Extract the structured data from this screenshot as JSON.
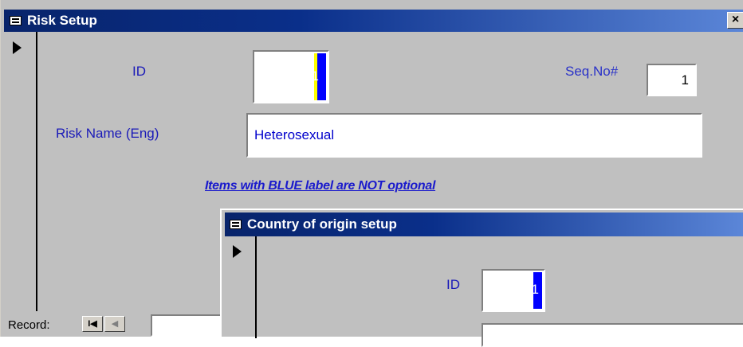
{
  "main_window": {
    "title": "Risk Setup",
    "close_glyph": "×",
    "record_indicator_icon": "current-record-arrow-icon",
    "fields": {
      "id_label": "ID",
      "id_value": "1",
      "seq_label": "Seq.No#",
      "seq_value": "1",
      "risk_name_label": "Risk Name (Eng)",
      "risk_name_value": "Heterosexual"
    },
    "warning_text": "Items with BLUE label are NOT optional",
    "navigation": {
      "record_label": "Record:",
      "first_glyph": "I◀",
      "prev_glyph": "◀"
    }
  },
  "child_window": {
    "title": "Country of origin setup",
    "record_indicator_icon": "current-record-arrow-icon",
    "fields": {
      "id_label": "ID",
      "id_value": "1"
    }
  },
  "colors": {
    "title_bar_start": "#08246b",
    "title_bar_end": "#5b86d8",
    "window_bg": "#c0c0c0",
    "label_blue": "#1a1ab8",
    "selection_blue": "#0000ff"
  }
}
